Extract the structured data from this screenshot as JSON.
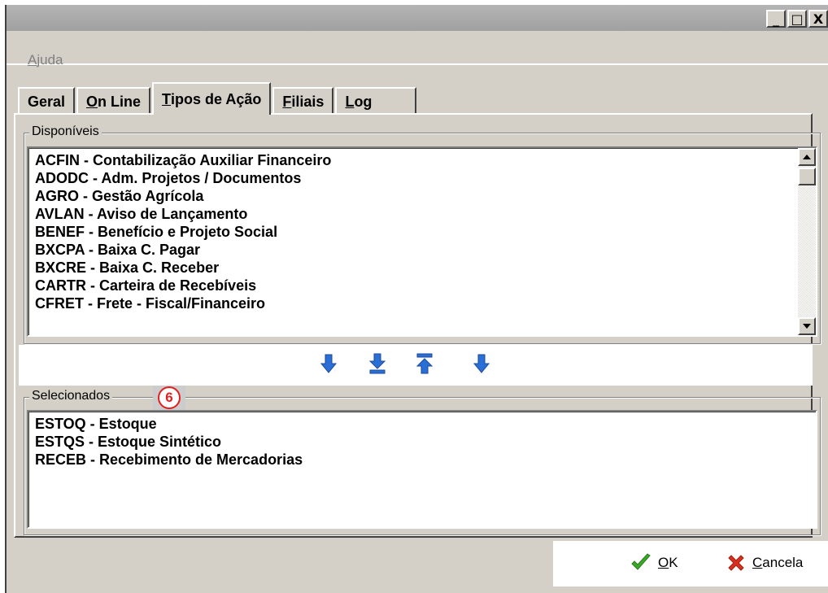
{
  "window": {
    "controls": {
      "minimize": "_",
      "maximize": "□",
      "close": "X"
    }
  },
  "menu": {
    "items": [
      {
        "label_first": "A",
        "label_rest": "juda"
      }
    ]
  },
  "tabs": [
    {
      "first": "Geral",
      "rest": "",
      "underline_first": false
    },
    {
      "first": "O",
      "rest": "n Line",
      "underline_first": true
    },
    {
      "first": "T",
      "rest": "ipos de Ação",
      "underline_first": true
    },
    {
      "first": "F",
      "rest": "iliais",
      "underline_first": true
    },
    {
      "first": "L",
      "rest": "og",
      "underline_first": true
    }
  ],
  "available": {
    "title": "Disponíveis",
    "items": [
      "ACFIN - Contabilização Auxiliar Financeiro",
      "ADODC - Adm. Projetos / Documentos",
      "AGRO - Gestão Agrícola",
      "AVLAN - Aviso de Lançamento",
      "BENEF - Benefício e Projeto Social",
      "BXCPA - Baixa C. Pagar",
      "BXCRE - Baixa C. Receber",
      "CARTR - Carteira de Recebíveis",
      "CFRET - Frete - Fiscal/Financeiro"
    ]
  },
  "selected": {
    "title": "Selecionados",
    "badge": "6",
    "items": [
      "ESTOQ - Estoque",
      "ESTQS - Estoque Sintético",
      "RECEB - Recebimento de Mercadorias"
    ]
  },
  "footer": {
    "ok_first": "O",
    "ok_rest": "K",
    "cancel_first": "C",
    "cancel_rest": "ancela"
  },
  "colors": {
    "arrow": "#2a6fd6",
    "ok": "#3aa82a",
    "cancel": "#d83020",
    "badge": "#e02020"
  }
}
